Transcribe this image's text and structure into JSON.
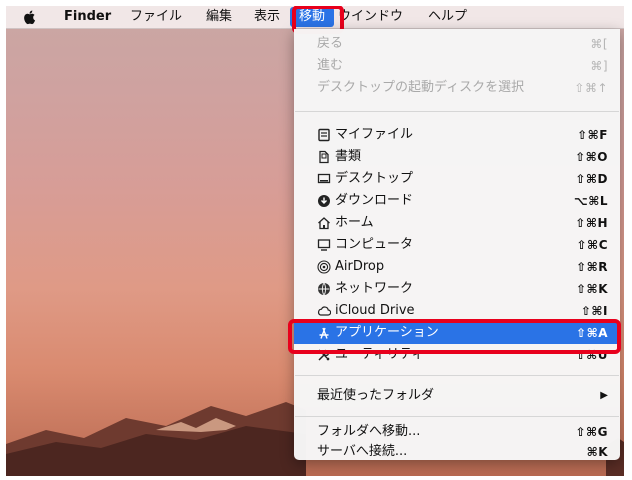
{
  "menubar": {
    "apple_icon": "apple-logo-icon",
    "items": [
      "Finder",
      "ファイル",
      "編集",
      "表示",
      "移動",
      "ウインドウ",
      "ヘルプ"
    ],
    "active": "移動",
    "highlight_color": "#e8001c",
    "accent_color": "#2a73e6"
  },
  "go_menu": {
    "disabled": [
      {
        "label": "戻る",
        "shortcut": "⌘["
      },
      {
        "label": "進む",
        "shortcut": "⌘]"
      },
      {
        "label": "デスクトップの起動ディスクを選択",
        "shortcut": "⇧⌘↑"
      }
    ],
    "places": [
      {
        "icon": "my-files-icon",
        "label": "マイファイル",
        "shortcut": "⇧⌘F"
      },
      {
        "icon": "documents-icon",
        "label": "書類",
        "shortcut": "⇧⌘O"
      },
      {
        "icon": "desktop-icon",
        "label": "デスクトップ",
        "shortcut": "⇧⌘D"
      },
      {
        "icon": "downloads-icon",
        "label": "ダウンロード",
        "shortcut": "⌥⌘L"
      },
      {
        "icon": "home-icon",
        "label": "ホーム",
        "shortcut": "⇧⌘H"
      },
      {
        "icon": "computer-icon",
        "label": "コンピュータ",
        "shortcut": "⇧⌘C"
      },
      {
        "icon": "airdrop-icon",
        "label": "AirDrop",
        "shortcut": "⇧⌘R"
      },
      {
        "icon": "network-icon",
        "label": "ネットワーク",
        "shortcut": "⇧⌘K"
      },
      {
        "icon": "icloud-icon",
        "label": "iCloud Drive",
        "shortcut": "⇧⌘I"
      },
      {
        "icon": "applications-icon",
        "label": "アプリケーション",
        "shortcut": "⇧⌘A",
        "selected": true
      },
      {
        "icon": "utilities-icon",
        "label": "ユーティリティ",
        "shortcut": "⇧⌘U"
      }
    ],
    "recent": {
      "label": "最近使ったフォルダ",
      "submenu_arrow": "▶"
    },
    "goto": [
      {
        "label": "フォルダへ移動...",
        "shortcut": "⇧⌘G"
      },
      {
        "label": "サーバへ接続...",
        "shortcut": "⌘K"
      }
    ]
  }
}
